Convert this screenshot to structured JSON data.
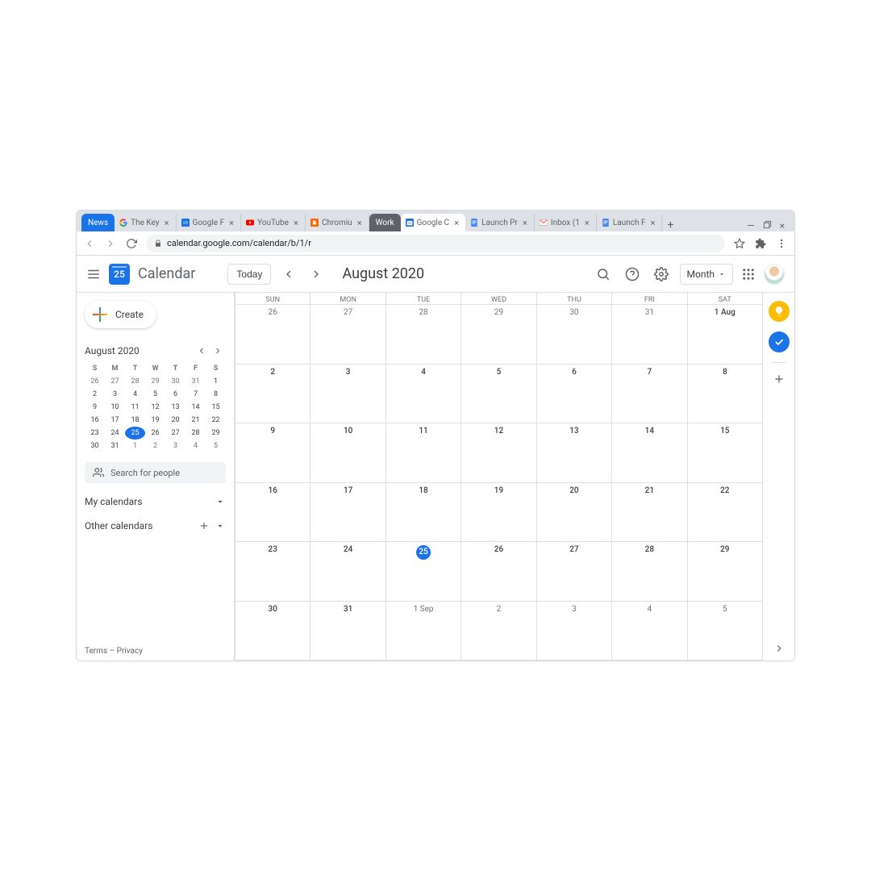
{
  "browser": {
    "tabs": [
      {
        "label": "News",
        "type": "group-news"
      },
      {
        "label": "The Key",
        "favicon": "G"
      },
      {
        "label": "Google F",
        "favicon": "GB"
      },
      {
        "label": "YouTube",
        "favicon": "YT"
      },
      {
        "label": "Chromiu",
        "favicon": "B"
      },
      {
        "label": "Work",
        "type": "group-work"
      },
      {
        "label": "Google C",
        "favicon": "CAL",
        "active": true
      },
      {
        "label": "Launch Pr",
        "favicon": "DOC"
      },
      {
        "label": "Inbox (1",
        "favicon": "M"
      },
      {
        "label": "Launch F",
        "favicon": "DOC"
      }
    ],
    "url": "calendar.google.com/calendar/b/1/r"
  },
  "header": {
    "logo_day": "25",
    "app_title": "Calendar",
    "today_label": "Today",
    "month_label": "August 2020",
    "view_label": "Month"
  },
  "sidebar": {
    "create_label": "Create",
    "mini_month": "August 2020",
    "mini_days": [
      "S",
      "M",
      "T",
      "W",
      "T",
      "F",
      "S"
    ],
    "mini_rows": [
      [
        {
          "n": "26"
        },
        {
          "n": "27"
        },
        {
          "n": "28"
        },
        {
          "n": "29"
        },
        {
          "n": "30"
        },
        {
          "n": "31"
        },
        {
          "n": "1",
          "in": true
        }
      ],
      [
        {
          "n": "2",
          "in": true
        },
        {
          "n": "3",
          "in": true
        },
        {
          "n": "4",
          "in": true
        },
        {
          "n": "5",
          "in": true
        },
        {
          "n": "6",
          "in": true
        },
        {
          "n": "7",
          "in": true
        },
        {
          "n": "8",
          "in": true
        }
      ],
      [
        {
          "n": "9",
          "in": true
        },
        {
          "n": "10",
          "in": true
        },
        {
          "n": "11",
          "in": true
        },
        {
          "n": "12",
          "in": true
        },
        {
          "n": "13",
          "in": true
        },
        {
          "n": "14",
          "in": true
        },
        {
          "n": "15",
          "in": true
        }
      ],
      [
        {
          "n": "16",
          "in": true
        },
        {
          "n": "17",
          "in": true
        },
        {
          "n": "18",
          "in": true
        },
        {
          "n": "19",
          "in": true
        },
        {
          "n": "20",
          "in": true
        },
        {
          "n": "21",
          "in": true
        },
        {
          "n": "22",
          "in": true
        }
      ],
      [
        {
          "n": "23",
          "in": true
        },
        {
          "n": "24",
          "in": true
        },
        {
          "n": "25",
          "in": true,
          "today": true
        },
        {
          "n": "26",
          "in": true
        },
        {
          "n": "27",
          "in": true
        },
        {
          "n": "28",
          "in": true
        },
        {
          "n": "29",
          "in": true
        }
      ],
      [
        {
          "n": "30",
          "in": true
        },
        {
          "n": "31",
          "in": true
        },
        {
          "n": "1"
        },
        {
          "n": "2"
        },
        {
          "n": "3"
        },
        {
          "n": "4"
        },
        {
          "n": "5"
        }
      ]
    ],
    "search_placeholder": "Search for people",
    "my_calendars": "My calendars",
    "other_calendars": "Other calendars",
    "terms": "Terms",
    "privacy": "Privacy"
  },
  "grid": {
    "day_names": [
      "SUN",
      "MON",
      "TUE",
      "WED",
      "THU",
      "FRI",
      "SAT"
    ],
    "weeks": [
      [
        {
          "n": "26"
        },
        {
          "n": "27"
        },
        {
          "n": "28"
        },
        {
          "n": "29"
        },
        {
          "n": "30"
        },
        {
          "n": "31"
        },
        {
          "n": "1 Aug",
          "in": true
        }
      ],
      [
        {
          "n": "2",
          "in": true
        },
        {
          "n": "3",
          "in": true
        },
        {
          "n": "4",
          "in": true
        },
        {
          "n": "5",
          "in": true
        },
        {
          "n": "6",
          "in": true
        },
        {
          "n": "7",
          "in": true
        },
        {
          "n": "8",
          "in": true
        }
      ],
      [
        {
          "n": "9",
          "in": true
        },
        {
          "n": "10",
          "in": true
        },
        {
          "n": "11",
          "in": true
        },
        {
          "n": "12",
          "in": true
        },
        {
          "n": "13",
          "in": true
        },
        {
          "n": "14",
          "in": true
        },
        {
          "n": "15",
          "in": true
        }
      ],
      [
        {
          "n": "16",
          "in": true
        },
        {
          "n": "17",
          "in": true
        },
        {
          "n": "18",
          "in": true
        },
        {
          "n": "19",
          "in": true
        },
        {
          "n": "20",
          "in": true
        },
        {
          "n": "21",
          "in": true
        },
        {
          "n": "22",
          "in": true
        }
      ],
      [
        {
          "n": "23",
          "in": true
        },
        {
          "n": "24",
          "in": true
        },
        {
          "n": "25",
          "in": true,
          "today": true
        },
        {
          "n": "26",
          "in": true
        },
        {
          "n": "27",
          "in": true
        },
        {
          "n": "28",
          "in": true
        },
        {
          "n": "29",
          "in": true
        }
      ],
      [
        {
          "n": "30",
          "in": true
        },
        {
          "n": "31",
          "in": true
        },
        {
          "n": "1 Sep"
        },
        {
          "n": "2"
        },
        {
          "n": "3"
        },
        {
          "n": "4"
        },
        {
          "n": "5"
        }
      ]
    ]
  }
}
